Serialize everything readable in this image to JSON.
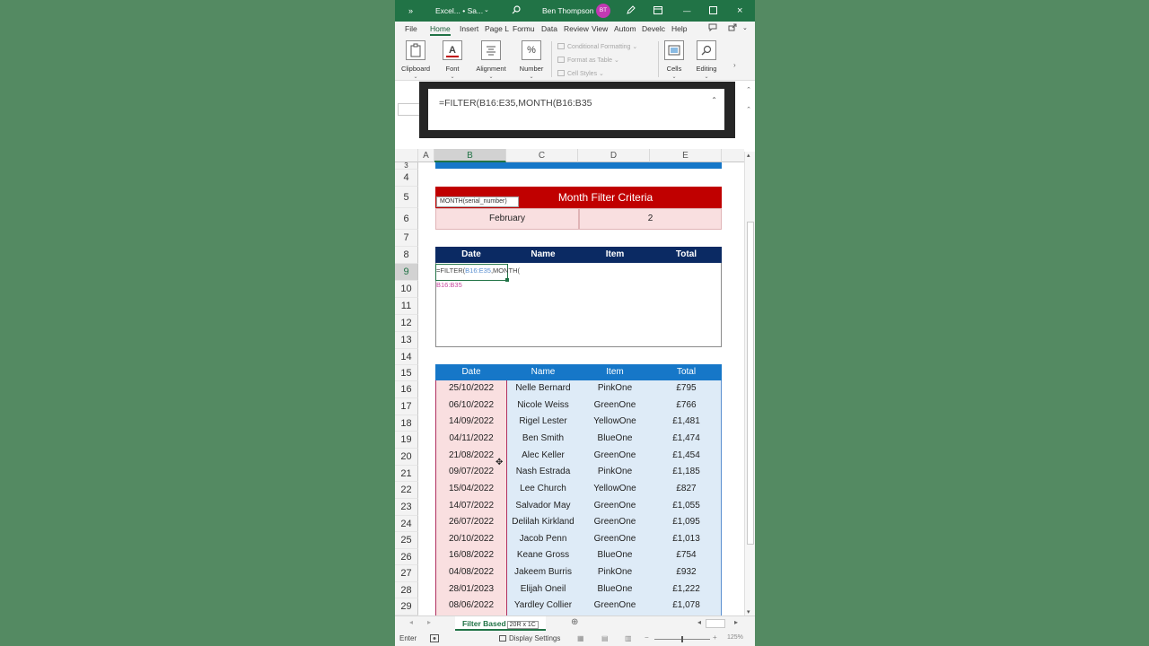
{
  "window": {
    "title": "Excel... • Sa...",
    "user": "Ben Thompson",
    "initials": "BT"
  },
  "tabs": [
    "File",
    "Home",
    "Insert",
    "Page L",
    "Formu",
    "Data",
    "Review",
    "View",
    "Autom",
    "Develc",
    "Help"
  ],
  "ribbon": {
    "clipboard": "Clipboard",
    "font": "Font",
    "alignment": "Alignment",
    "number": "Number",
    "conditional_formatting": "Conditional Formatting",
    "format_as_table": "Format as Table",
    "cell_styles": "Cell Styles",
    "cells": "Cells",
    "editing": "Editing"
  },
  "formula_bar": {
    "text": "=FILTER(B16:E35,MONTH(B16:B35"
  },
  "columns": [
    "A",
    "B",
    "C",
    "D",
    "E"
  ],
  "rows": [
    "3",
    "4",
    "5",
    "6",
    "7",
    "8",
    "9",
    "10",
    "11",
    "12",
    "13",
    "14",
    "15",
    "16",
    "17",
    "18",
    "19",
    "20",
    "21",
    "22",
    "23",
    "24",
    "25",
    "26",
    "27",
    "28",
    "29"
  ],
  "criteria": {
    "title": "Month Filter Criteria",
    "tooltip": "MONTH(serial_number)",
    "month_name": "February",
    "month_number": "2"
  },
  "result_table": {
    "headers": [
      "Date",
      "Name",
      "Item",
      "Total"
    ],
    "formula_part1": "=FILTER(",
    "formula_ref1": "B16:E35",
    "formula_part2": ",MONTH(",
    "formula_ref2": "B16:B35"
  },
  "source_table": {
    "headers": [
      "Date",
      "Name",
      "Item",
      "Total"
    ],
    "rows": [
      [
        "25/10/2022",
        "Nelle Bernard",
        "PinkOne",
        "£795"
      ],
      [
        "06/10/2022",
        "Nicole Weiss",
        "GreenOne",
        "£766"
      ],
      [
        "14/09/2022",
        "Rigel Lester",
        "YellowOne",
        "£1,481"
      ],
      [
        "04/11/2022",
        "Ben Smith",
        "BlueOne",
        "£1,474"
      ],
      [
        "21/08/2022",
        "Alec Keller",
        "GreenOne",
        "£1,454"
      ],
      [
        "09/07/2022",
        "Nash Estrada",
        "PinkOne",
        "£1,185"
      ],
      [
        "15/04/2022",
        "Lee Church",
        "YellowOne",
        "£827"
      ],
      [
        "14/07/2022",
        "Salvador May",
        "GreenOne",
        "£1,055"
      ],
      [
        "26/07/2022",
        "Delilah Kirkland",
        "GreenOne",
        "£1,095"
      ],
      [
        "20/10/2022",
        "Jacob Penn",
        "GreenOne",
        "£1,013"
      ],
      [
        "16/08/2022",
        "Keane Gross",
        "BlueOne",
        "£754"
      ],
      [
        "04/08/2022",
        "Jakeem Burris",
        "PinkOne",
        "£932"
      ],
      [
        "28/01/2023",
        "Elijah Oneil",
        "BlueOne",
        "£1,222"
      ],
      [
        "08/06/2022",
        "Yardley Collier",
        "GreenOne",
        "£1,078"
      ]
    ]
  },
  "sheet": {
    "tab": "Filter Based",
    "size_tip": "20R x 1C"
  },
  "status": {
    "mode": "Enter",
    "display_settings": "Display Settings",
    "zoom": "125%"
  },
  "colors": {
    "excel_green": "#217346",
    "criteria_red": "#c00000",
    "header_navy": "#0b2a63",
    "header_blue": "#1677c8",
    "date_pink": "#f9dfe0",
    "table_blue": "#deebf7"
  }
}
